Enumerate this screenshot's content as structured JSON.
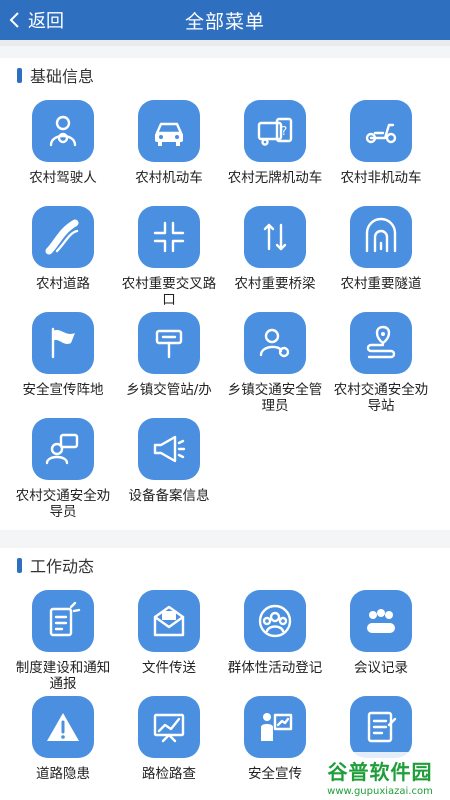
{
  "header": {
    "back_label": "返回",
    "title": "全部菜单"
  },
  "sections": [
    {
      "title": "基础信息",
      "items": [
        {
          "label": "农村驾驶人",
          "icon": "driver-icon"
        },
        {
          "label": "农村机动车",
          "icon": "car-icon"
        },
        {
          "label": "农村无牌机动车",
          "icon": "unlicensed-vehicle-icon"
        },
        {
          "label": "农村非机动车",
          "icon": "scooter-icon"
        },
        {
          "label": "农村道路",
          "icon": "road-icon"
        },
        {
          "label": "农村重要交叉路口",
          "icon": "intersection-icon"
        },
        {
          "label": "农村重要桥梁",
          "icon": "bridge-icon"
        },
        {
          "label": "农村重要隧道",
          "icon": "tunnel-icon"
        },
        {
          "label": "安全宣传阵地",
          "icon": "flag-icon"
        },
        {
          "label": "乡镇交管站/办",
          "icon": "signpost-icon"
        },
        {
          "label": "乡镇交通安全管理员",
          "icon": "admin-user-icon"
        },
        {
          "label": "农村交通安全劝导站",
          "icon": "location-route-icon"
        },
        {
          "label": "农村交通安全劝导员",
          "icon": "chat-user-icon"
        },
        {
          "label": "设备备案信息",
          "icon": "megaphone-icon"
        }
      ]
    },
    {
      "title": "工作动态",
      "items": [
        {
          "label": "制度建设和通知通报",
          "icon": "document-icon"
        },
        {
          "label": "文件传送",
          "icon": "mail-icon"
        },
        {
          "label": "群体性活动登记",
          "icon": "group-icon"
        },
        {
          "label": "会议记录",
          "icon": "meeting-icon"
        },
        {
          "label": "道路隐患",
          "icon": "warning-icon"
        },
        {
          "label": "路检路查",
          "icon": "chart-board-icon"
        },
        {
          "label": "安全宣传",
          "icon": "presentation-icon"
        },
        {
          "label": "",
          "icon": "notepad-icon"
        }
      ]
    }
  ],
  "watermark": {
    "main": "谷普软件园",
    "sub": "www.gupuxiazai.com"
  },
  "colors": {
    "header": "#2f6fc0",
    "tile": "#4a8fe0",
    "accent_bar": "#2f6fc0"
  }
}
